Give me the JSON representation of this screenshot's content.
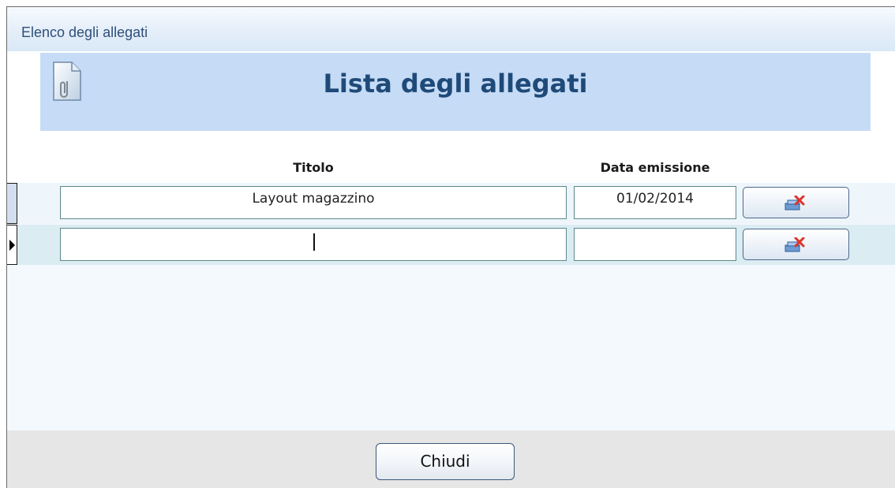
{
  "window": {
    "title": "Elenco degli allegati"
  },
  "header": {
    "title": "Lista degli allegati",
    "icon": "attachment-document-icon"
  },
  "table": {
    "columns": {
      "titolo": "Titolo",
      "data_emissione": "Data emissione"
    },
    "rows": [
      {
        "titolo": "Layout magazzino",
        "data_emissione": "01/02/2014",
        "delete_icon": "delete-record-icon"
      },
      {
        "titolo": "",
        "data_emissione": "",
        "delete_icon": "delete-record-icon",
        "current": true
      }
    ]
  },
  "footer": {
    "close_label": "Chiudi"
  },
  "colors": {
    "titlebar_text": "#2e4f78",
    "header_band": "#c5dbf6",
    "header_title": "#1f4a78",
    "field_border": "#5b8a8a",
    "footer_bg": "#e6e6e6"
  }
}
